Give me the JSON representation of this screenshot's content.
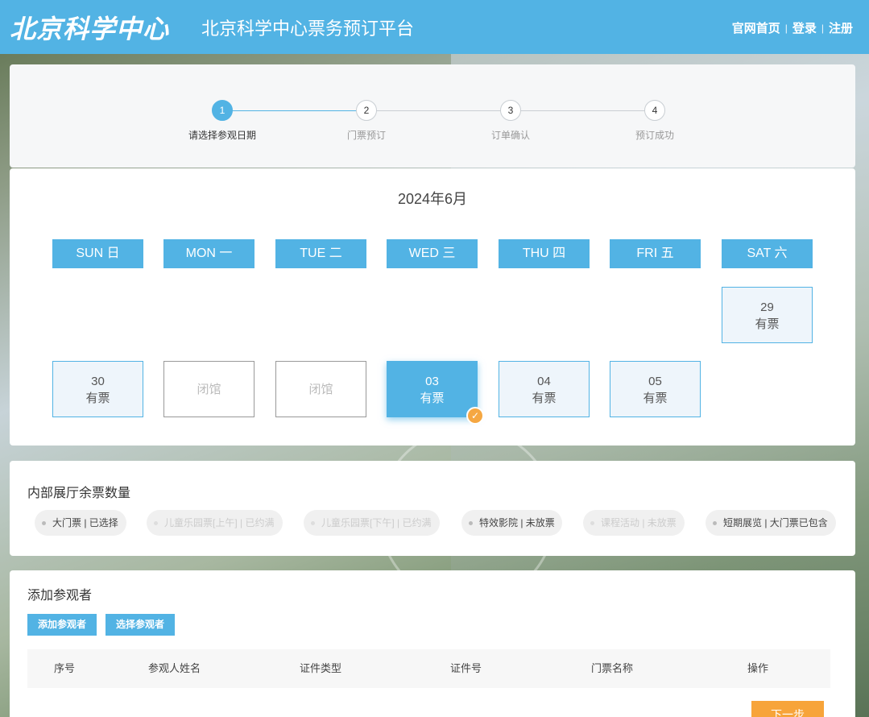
{
  "header": {
    "logo_text": "北京科学中心",
    "platform_title": "北京科学中心票务预订平台",
    "links": [
      "官网首页",
      "登录",
      "注册"
    ],
    "separator": "|"
  },
  "steps": [
    {
      "number": "1",
      "label": "请选择参观日期",
      "active": true
    },
    {
      "number": "2",
      "label": "门票预订",
      "active": false
    },
    {
      "number": "3",
      "label": "订单确认",
      "active": false
    },
    {
      "number": "4",
      "label": "预订成功",
      "active": false
    }
  ],
  "calendar": {
    "month": "2024年6月",
    "weekdays": [
      "SUN 日",
      "MON 一",
      "TUE 二",
      "WED 三",
      "THU 四",
      "FRI 五",
      "SAT 六"
    ],
    "days": [
      {
        "date": "29",
        "status": "有票",
        "type": "available"
      },
      {
        "date": "30",
        "status": "有票",
        "type": "available"
      },
      {
        "date": "",
        "status": "闭馆",
        "type": "closed"
      },
      {
        "date": "",
        "status": "闭馆",
        "type": "closed"
      },
      {
        "date": "03",
        "status": "有票",
        "type": "selected"
      },
      {
        "date": "04",
        "status": "有票",
        "type": "available"
      },
      {
        "date": "05",
        "status": "有票",
        "type": "available"
      }
    ],
    "check_mark": "✓"
  },
  "halls": {
    "title": "内部展厅余票数量",
    "chips": [
      {
        "text": "大门票 | 已选择",
        "disabled": false
      },
      {
        "text": "儿童乐园票[上午] | 已约满",
        "disabled": true
      },
      {
        "text": "儿童乐园票[下午] | 已约满",
        "disabled": true
      },
      {
        "text": "特效影院 | 未放票",
        "disabled": false
      },
      {
        "text": "课程活动 | 未放票",
        "disabled": true
      },
      {
        "text": "短期展览 | 大门票已包含",
        "disabled": false
      }
    ]
  },
  "visitors": {
    "title": "添加参观者",
    "add_button": "添加参观者",
    "select_button": "选择参观者",
    "columns": [
      "序号",
      "参观人姓名",
      "证件类型",
      "证件号",
      "门票名称",
      "操作"
    ],
    "next_button": "下一步"
  },
  "colors": {
    "primary": "#52b3e4",
    "accent": "#f7a43a"
  }
}
